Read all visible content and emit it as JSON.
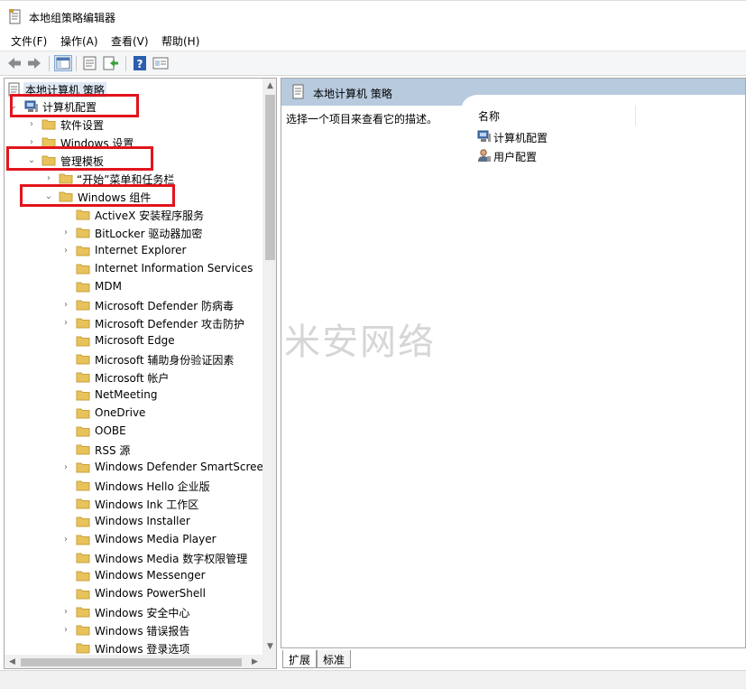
{
  "window": {
    "title": "本地组策略编辑器"
  },
  "menu": [
    {
      "label": "文件(F)"
    },
    {
      "label": "操作(A)"
    },
    {
      "label": "查看(V)"
    },
    {
      "label": "帮助(H)"
    }
  ],
  "toolbar": {
    "icons": [
      "back-arrow-icon",
      "forward-arrow-icon",
      "show-hide-tree-icon",
      "properties-icon",
      "export-list-icon",
      "help-icon",
      "console-view-icon"
    ]
  },
  "tree": {
    "root": "本地计算机 策略",
    "items": [
      {
        "label": "计算机配置",
        "expanded": true
      },
      {
        "label": "软件设置",
        "expanded": false
      },
      {
        "label": "Windows 设置",
        "expanded": false
      },
      {
        "label": "管理模板",
        "expanded": true
      },
      {
        "label": "“开始”菜单和任务栏",
        "expanded": false
      },
      {
        "label": "Windows 组件",
        "expanded": true
      },
      {
        "label": "ActiveX 安装程序服务"
      },
      {
        "label": "BitLocker 驱动器加密",
        "expandable": true
      },
      {
        "label": "Internet Explorer",
        "expandable": true
      },
      {
        "label": "Internet Information Services"
      },
      {
        "label": "MDM"
      },
      {
        "label": "Microsoft Defender 防病毒",
        "expandable": true
      },
      {
        "label": "Microsoft Defender 攻击防护",
        "expandable": true
      },
      {
        "label": "Microsoft Edge"
      },
      {
        "label": "Microsoft 辅助身份验证因素"
      },
      {
        "label": "Microsoft 帐户"
      },
      {
        "label": "NetMeeting"
      },
      {
        "label": "OneDrive"
      },
      {
        "label": "OOBE"
      },
      {
        "label": "RSS 源"
      },
      {
        "label": "Windows Defender SmartScreen",
        "expandable": true
      },
      {
        "label": "Windows Hello 企业版"
      },
      {
        "label": "Windows Ink 工作区"
      },
      {
        "label": "Windows Installer"
      },
      {
        "label": "Windows Media Player",
        "expandable": true
      },
      {
        "label": "Windows Media 数字权限管理"
      },
      {
        "label": "Windows Messenger"
      },
      {
        "label": "Windows PowerShell"
      },
      {
        "label": "Windows 安全中心",
        "expandable": true
      },
      {
        "label": "Windows 错误报告",
        "expandable": true
      },
      {
        "label": "Windows 登录选项"
      }
    ]
  },
  "right": {
    "header_title": "本地计算机 策略",
    "description": "选择一个项目来查看它的描述。",
    "column_name": "名称",
    "items": [
      {
        "label": "计算机配置"
      },
      {
        "label": "用户配置"
      }
    ]
  },
  "tabs": [
    {
      "label": "扩展"
    },
    {
      "label": "标准"
    }
  ],
  "watermark": "米安网络",
  "colors": {
    "highlight_box": "#e2141c",
    "header_bg": "#b7cade",
    "folder": "#e8c25a"
  }
}
